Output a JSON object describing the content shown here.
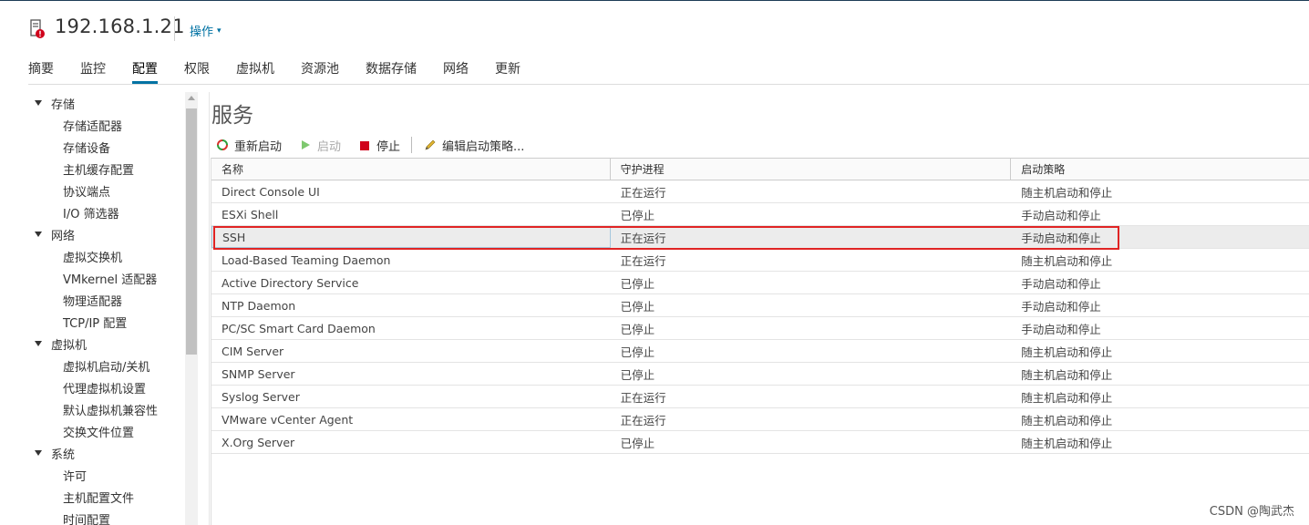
{
  "header": {
    "host_title": "192.168.1.21",
    "actions_label": "操作",
    "actions_chevron": "⌄"
  },
  "tabs": [
    {
      "label": "摘要"
    },
    {
      "label": "监控"
    },
    {
      "label": "配置",
      "active": true
    },
    {
      "label": "权限"
    },
    {
      "label": "虚拟机"
    },
    {
      "label": "资源池"
    },
    {
      "label": "数据存储"
    },
    {
      "label": "网络"
    },
    {
      "label": "更新"
    }
  ],
  "sidebar": {
    "groups": [
      {
        "label": "存储",
        "items": [
          "存储适配器",
          "存储设备",
          "主机缓存配置",
          "协议端点",
          "I/O 筛选器"
        ]
      },
      {
        "label": "网络",
        "items": [
          "虚拟交换机",
          "VMkernel 适配器",
          "物理适配器",
          "TCP/IP 配置"
        ]
      },
      {
        "label": "虚拟机",
        "items": [
          "虚拟机启动/关机",
          "代理虚拟机设置",
          "默认虚拟机兼容性",
          "交换文件位置"
        ]
      },
      {
        "label": "系统",
        "items": [
          "许可",
          "主机配置文件",
          "时间配置"
        ]
      }
    ]
  },
  "main": {
    "title": "服务",
    "toolbar": {
      "restart_label": "重新启动",
      "start_label": "启动",
      "stop_label": "停止",
      "edit_policy_label": "编辑启动策略..."
    },
    "table": {
      "columns": [
        "名称",
        "守护进程",
        "启动策略"
      ],
      "rows": [
        {
          "name": "Direct Console UI",
          "daemon": "正在运行",
          "policy": "随主机启动和停止"
        },
        {
          "name": "ESXi Shell",
          "daemon": "已停止",
          "policy": "手动启动和停止"
        },
        {
          "name": "SSH",
          "daemon": "正在运行",
          "policy": "手动启动和停止",
          "selected": true
        },
        {
          "name": "Load-Based Teaming Daemon",
          "daemon": "正在运行",
          "policy": "随主机启动和停止"
        },
        {
          "name": "Active Directory Service",
          "daemon": "已停止",
          "policy": "手动启动和停止"
        },
        {
          "name": "NTP Daemon",
          "daemon": "已停止",
          "policy": "手动启动和停止"
        },
        {
          "name": "PC/SC Smart Card Daemon",
          "daemon": "已停止",
          "policy": "手动启动和停止"
        },
        {
          "name": "CIM Server",
          "daemon": "已停止",
          "policy": "随主机启动和停止"
        },
        {
          "name": "SNMP Server",
          "daemon": "已停止",
          "policy": "随主机启动和停止"
        },
        {
          "name": "Syslog Server",
          "daemon": "正在运行",
          "policy": "随主机启动和停止"
        },
        {
          "name": "VMware vCenter Agent",
          "daemon": "正在运行",
          "policy": "随主机启动和停止"
        },
        {
          "name": "X.Org Server",
          "daemon": "已停止",
          "policy": "随主机启动和停止"
        }
      ]
    }
  },
  "icons": {
    "host": "host-warning-icon",
    "restart": "restart-icon",
    "start": "play-icon",
    "stop": "stop-icon",
    "edit": "pencil-icon"
  },
  "colors": {
    "accent": "#0072a3",
    "highlight_box": "#e02424",
    "stop_red": "#d0021b",
    "start_green": "#7ec86f"
  },
  "watermark": "CSDN @陶武杰"
}
